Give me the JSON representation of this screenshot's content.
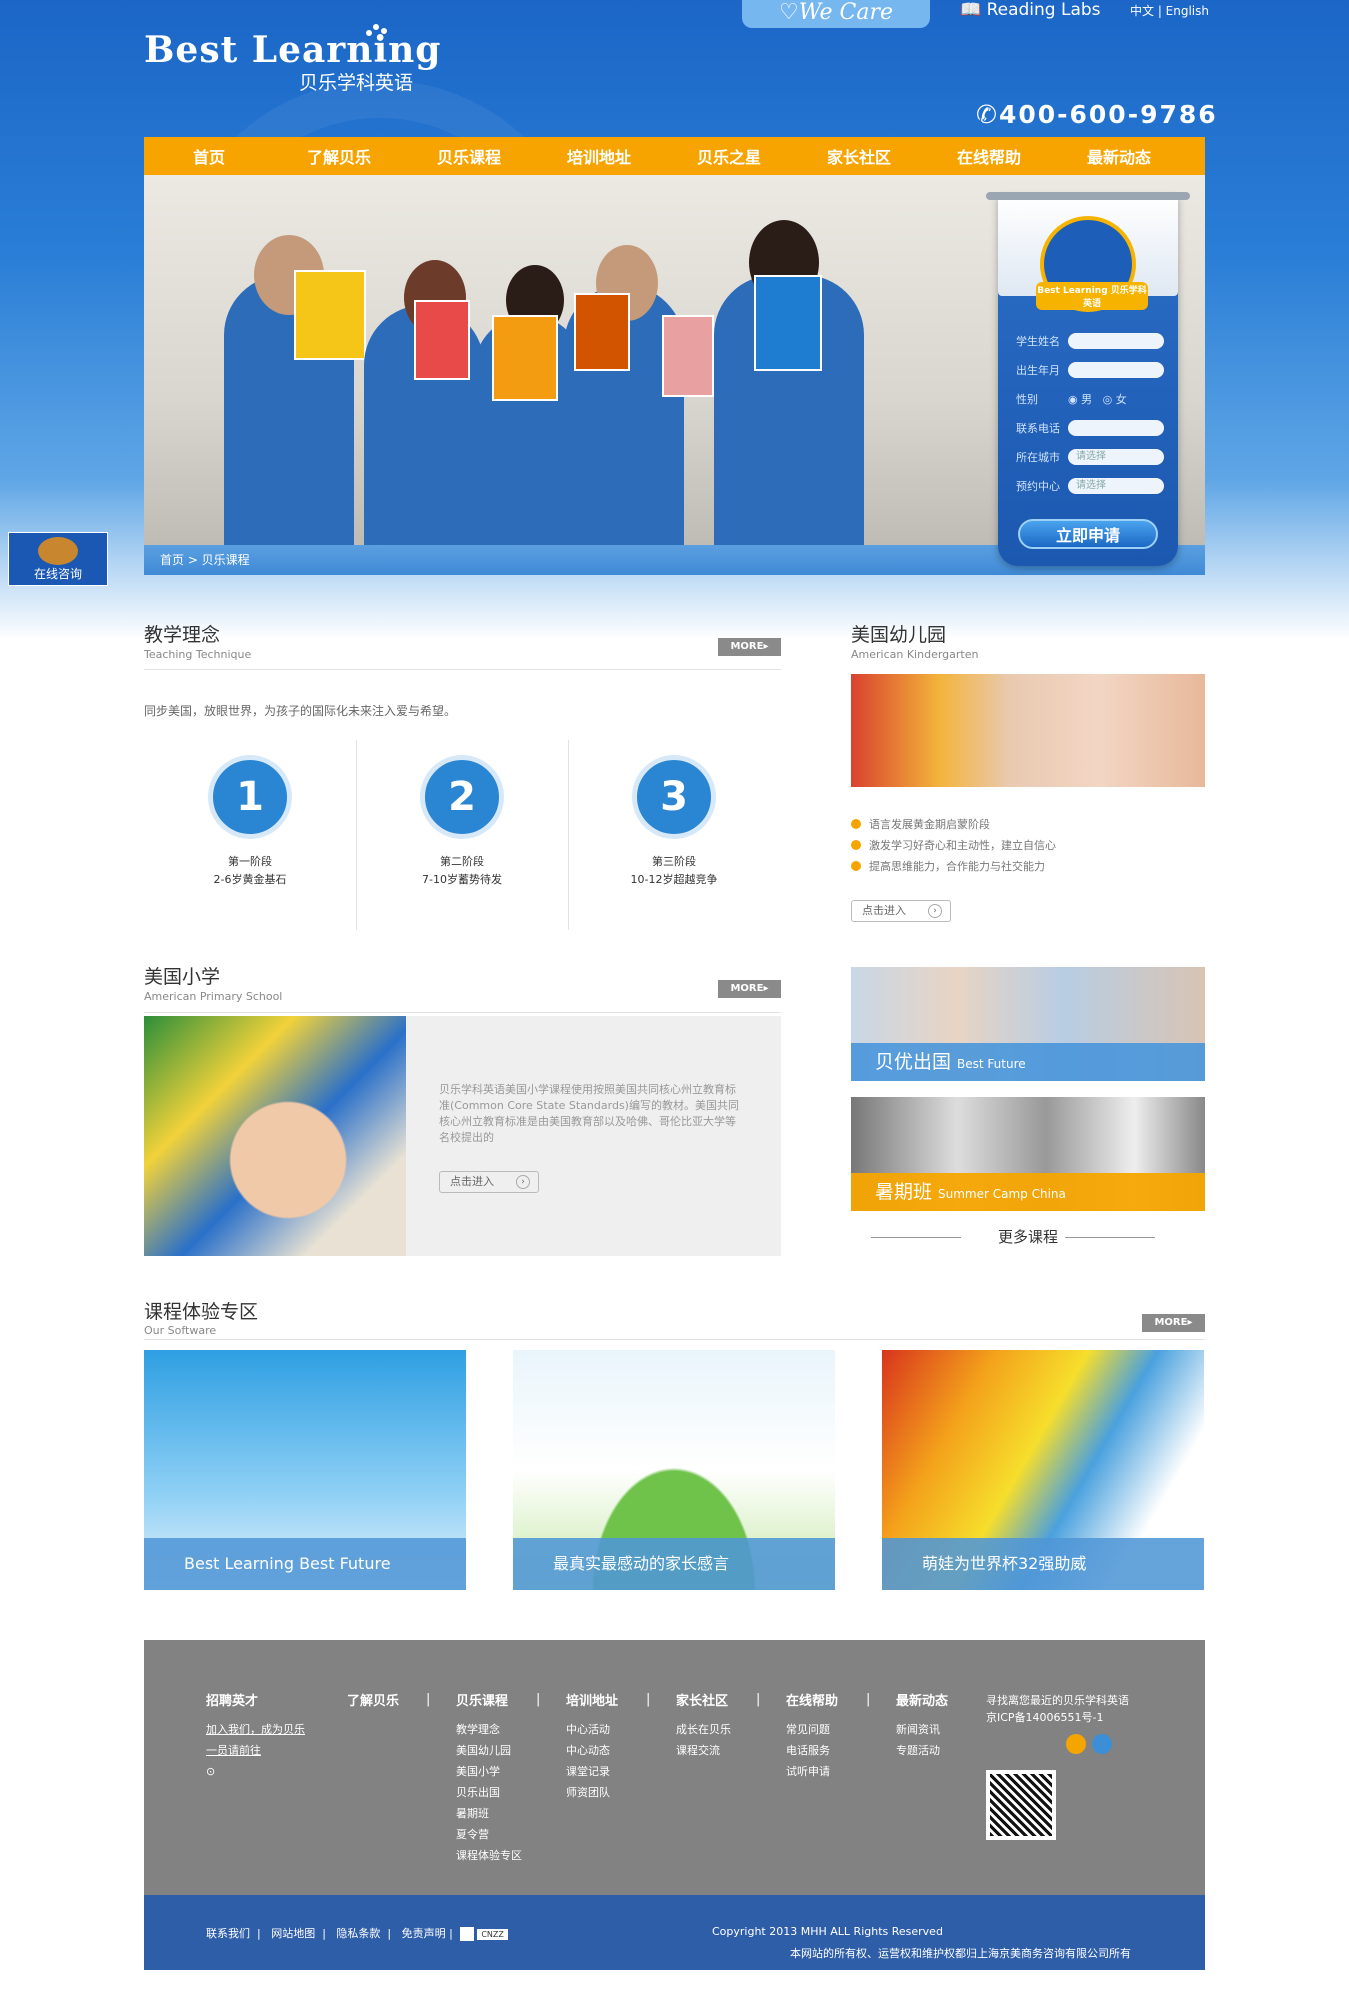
{
  "header": {
    "logo_en": "Best Learning",
    "logo_cn": "贝乐学科英语",
    "wecare": "We Care",
    "reading_labs": "Reading Labs",
    "lang": "中文 | English",
    "phone": "400-600-9786"
  },
  "nav": [
    "首页",
    "了解贝乐",
    "贝乐课程",
    "培训地址",
    "贝乐之星",
    "家长社区",
    "在线帮助",
    "最新动态"
  ],
  "breadcrumb": "首页 > 贝乐课程",
  "side_consult": "在线咨询",
  "form": {
    "badge_text": "Best Learning 贝乐学科英语",
    "name_label": "学生姓名",
    "birth_label": "出生年月",
    "gender_label": "性别",
    "male": "男",
    "female": "女",
    "phone_label": "联系电话",
    "city_label": "所在城市",
    "city_placeholder": "请选择",
    "center_label": "预约中心",
    "center_placeholder": "请选择",
    "submit": "立即申请"
  },
  "teaching": {
    "title": "教学理念",
    "subtitle": "Teaching Technique",
    "more": "MORE",
    "intro": "同步美国，放眼世界，为孩子的国际化未来注入爱与希望。",
    "steps": [
      {
        "num": "1",
        "t1": "第一阶段",
        "t2": "2-6岁黄金基石"
      },
      {
        "num": "2",
        "t1": "第二阶段",
        "t2": "7-10岁蓄势待发"
      },
      {
        "num": "3",
        "t1": "第三阶段",
        "t2": "10-12岁超越竞争"
      }
    ]
  },
  "kindergarten": {
    "title": "美国幼儿园",
    "subtitle": "American Kindergarten",
    "bullets": [
      "语言发展黄金期启蒙阶段",
      "激发学习好奇心和主动性，建立自信心",
      "提高思维能力，合作能力与社交能力"
    ],
    "enter": "点击进入"
  },
  "primary": {
    "title": "美国小学",
    "subtitle": "American Primary School",
    "more": "MORE",
    "text": "贝乐学科英语美国小学课程使用按照美国共同核心州立教育标准(Common Core State Standards)编写的教材。美国共同核心州立教育标准是由美国教育部以及哈佛、哥伦比亚大学等名校提出的",
    "enter": "点击进入"
  },
  "tiles": [
    {
      "cn": "贝优出国",
      "en": "Best Future"
    },
    {
      "cn": "暑期班",
      "en": "Summer Camp China"
    }
  ],
  "more_courses": "更多课程",
  "software": {
    "title": "课程体验专区",
    "subtitle": "Our Software",
    "more": "MORE",
    "items": [
      "Best Learning Best Future",
      "最真实最感动的家长感言",
      "萌娃为世界杯32强助威"
    ]
  },
  "footer": {
    "cols": [
      {
        "h": "招聘英才",
        "items": [
          "加入我们，成为贝乐",
          "一员请前往"
        ]
      },
      {
        "h": "了解贝乐",
        "items": []
      },
      {
        "h": "贝乐课程",
        "items": [
          "教学理念",
          "美国幼儿园",
          "美国小学",
          "贝乐出国",
          "暑期班",
          "夏令营",
          "课程体验专区"
        ]
      },
      {
        "h": "培训地址",
        "items": [
          "中心活动",
          "中心动态",
          "课堂记录",
          "师资团队"
        ]
      },
      {
        "h": "家长社区",
        "items": [
          "成长在贝乐",
          "课程交流"
        ]
      },
      {
        "h": "在线帮助",
        "items": [
          "常见问题",
          "电话服务",
          "试听申请"
        ]
      },
      {
        "h": "最新动态",
        "items": [
          "新闻资讯",
          "专题活动"
        ]
      }
    ],
    "contact1": "寻找离您最近的贝乐学科英语",
    "icp": "京ICP备14006551号-1",
    "links": [
      "联系我们",
      "网站地图",
      "隐私条款",
      "免责声明"
    ],
    "cnzz": "CNZZ",
    "copyright": "Copyright 2013 MHH ALL Rights Reserved",
    "rights": "本网站的所有权、运营权和维护权都归上海京美商务咨询有限公司所有"
  }
}
